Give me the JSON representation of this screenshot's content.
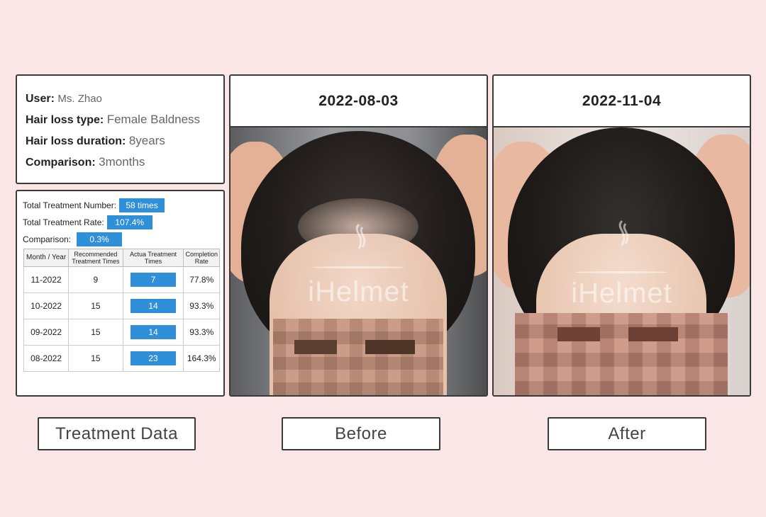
{
  "user_info": {
    "user_key": "User:",
    "user_val": "Ms. Zhao",
    "type_key": "Hair loss type:",
    "type_val": "Female Baldness",
    "duration_key": "Hair loss duration:",
    "duration_val": "8years",
    "comparison_key": "Comparison:",
    "comparison_val": "3months"
  },
  "treatment": {
    "total_number_label": "Total Treatment Number:",
    "total_number": "58 times",
    "total_rate_label": "Total Treatment Rate:",
    "total_rate": "107.4%",
    "comparison_label": "Comparison:",
    "comparison": "0.3%",
    "headers": [
      "Month / Year",
      "Recommended Treatment Times",
      "Actua Treatment Times",
      "Completion Rate"
    ],
    "rows": [
      {
        "month": "11-2022",
        "recommended": "9",
        "actual": "7",
        "rate": "77.8%"
      },
      {
        "month": "10-2022",
        "recommended": "15",
        "actual": "14",
        "rate": "93.3%"
      },
      {
        "month": "09-2022",
        "recommended": "15",
        "actual": "14",
        "rate": "93.3%"
      },
      {
        "month": "08-2022",
        "recommended": "15",
        "actual": "23",
        "rate": "164.3%"
      }
    ]
  },
  "before": {
    "date": "2022-08-03",
    "watermark": "iHelmet"
  },
  "after": {
    "date": "2022-11-04",
    "watermark": "iHelmet"
  },
  "labels": {
    "data": "Treatment Data",
    "before": "Before",
    "after": "After"
  },
  "colors": {
    "background": "#fae6e6",
    "accent": "#2f8fd8",
    "border": "#3a3a3a"
  }
}
